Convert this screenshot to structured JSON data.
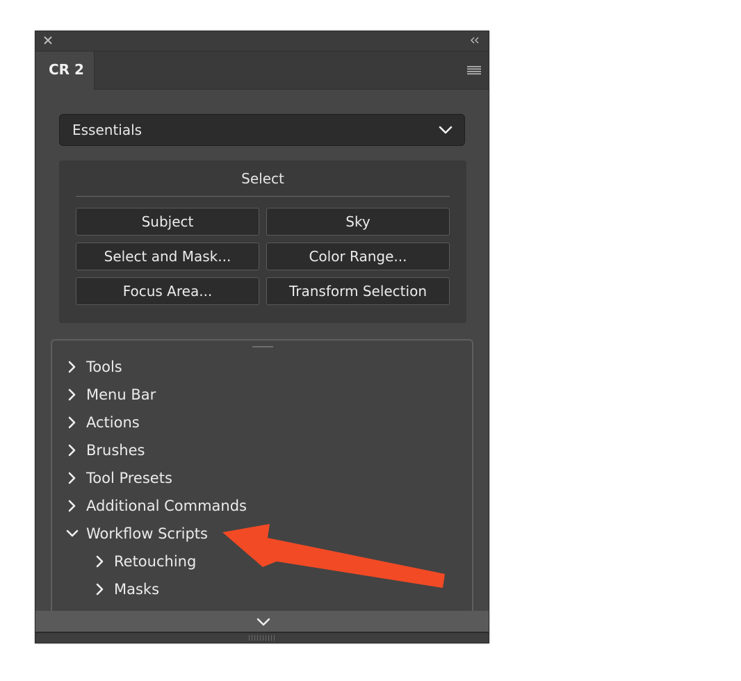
{
  "panel": {
    "tab_label": "CR 2"
  },
  "workspace": {
    "selected": "Essentials"
  },
  "select_section": {
    "title": "Select",
    "buttons": [
      {
        "label": "Subject"
      },
      {
        "label": "Sky"
      },
      {
        "label": "Select and Mask..."
      },
      {
        "label": "Color Range..."
      },
      {
        "label": "Focus Area..."
      },
      {
        "label": "Transform Selection"
      }
    ]
  },
  "tree": {
    "items": [
      {
        "label": "Tools",
        "expanded": false,
        "level": 0
      },
      {
        "label": "Menu Bar",
        "expanded": false,
        "level": 0
      },
      {
        "label": "Actions",
        "expanded": false,
        "level": 0
      },
      {
        "label": "Brushes",
        "expanded": false,
        "level": 0
      },
      {
        "label": "Tool Presets",
        "expanded": false,
        "level": 0
      },
      {
        "label": "Additional Commands",
        "expanded": false,
        "level": 0
      },
      {
        "label": "Workflow Scripts",
        "expanded": true,
        "level": 0
      },
      {
        "label": "Retouching",
        "expanded": false,
        "level": 1
      },
      {
        "label": "Masks",
        "expanded": false,
        "level": 1
      }
    ]
  },
  "annotation": {
    "arrow_color": "#f24a25"
  },
  "icons": {
    "close": "close-icon",
    "collapse": "double-chevron-left-icon",
    "panel_menu": "hamburger-menu-icon",
    "dropdown": "chevron-down-icon",
    "tree_collapsed": "chevron-right-icon",
    "tree_expanded": "chevron-down-icon",
    "scroll_more": "chevron-down-icon",
    "resize": "resize-grip-icon"
  }
}
